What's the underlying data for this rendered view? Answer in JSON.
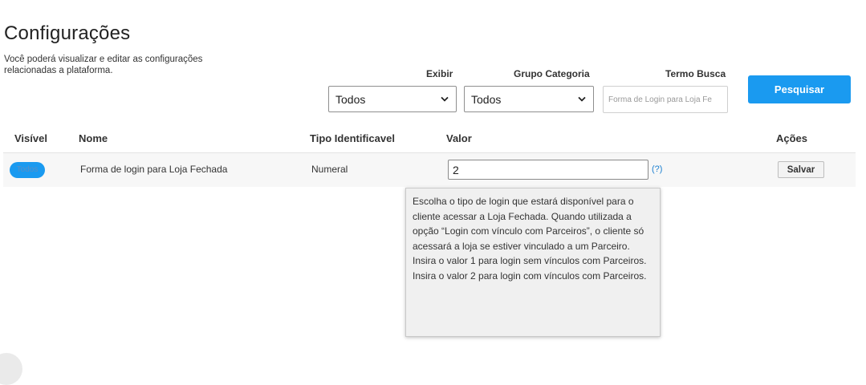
{
  "page": {
    "title": "Configurações",
    "description": "Você poderá visualizar e editar as configurações relacionadas a plataforma."
  },
  "filters": {
    "exibir": {
      "label": "Exibir",
      "selected": "Todos"
    },
    "grupo_categoria": {
      "label": "Grupo Categoria",
      "selected": "Todos"
    },
    "termo_busca": {
      "label": "Termo Busca",
      "value": "Forma de Login para Loja Fe"
    },
    "search_button_label": "Pesquisar"
  },
  "table": {
    "columns": [
      "Visível",
      "Nome",
      "Tipo Identificavel",
      "Valor",
      "Ações"
    ],
    "rows": [
      {
        "visivel_badge": "Todos",
        "nome": "Forma de login para Loja Fechada",
        "tipo": "Numeral",
        "valor": "2",
        "help_label": "(?)",
        "action_label": "Salvar"
      }
    ]
  },
  "tooltip": {
    "paragraphs": [
      "Escolha o tipo de login que estará disponível para o cliente acessar a Loja Fechada. Quando utilizada a opção “Login com vínculo com Parceiros”, o cliente só acessará a loja se estiver vinculado a um Parceiro.",
      "Insira o valor 1 para login sem vínculos com Parceiros.",
      "Insira o valor 2 para login com vínculos com Parceiros."
    ]
  },
  "icons": {
    "select_chevron": "chevron-down-icon"
  },
  "colors": {
    "accent": "#1a9af0",
    "link": "#1a7fd0",
    "row_background": "#f7f7f7",
    "tooltip_background": "#f0f0f0"
  }
}
